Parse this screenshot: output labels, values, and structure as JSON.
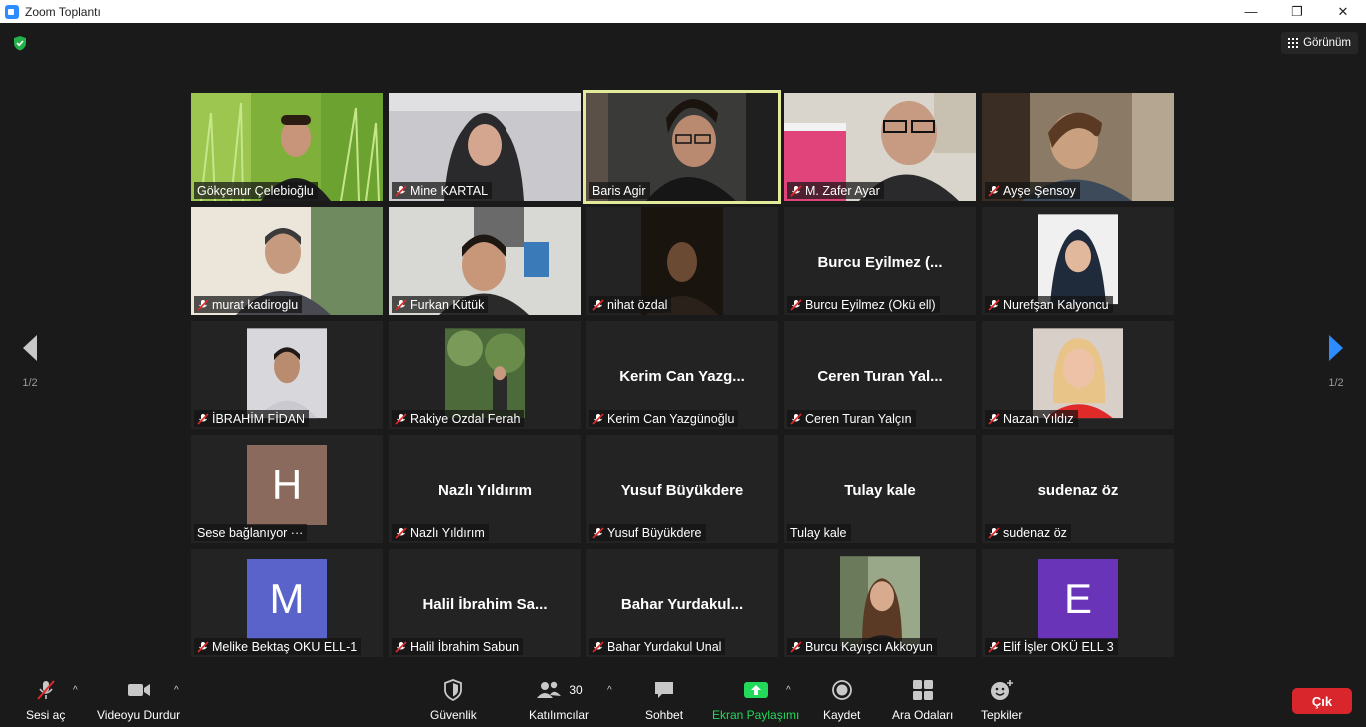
{
  "window": {
    "title": "Zoom Toplantı",
    "controls": [
      "—",
      "❐",
      "✕"
    ]
  },
  "header": {
    "view_label": "Görünüm"
  },
  "pagination": {
    "left": "1/2",
    "right": "1/2"
  },
  "participants": [
    {
      "name": "Gökçenur Çelebioğlu",
      "muted": false
    },
    {
      "name": "Mine KARTAL",
      "muted": true
    },
    {
      "name": "Baris Agir",
      "muted": false
    },
    {
      "name": "M. Zafer Ayar",
      "muted": true
    },
    {
      "name": "Ayşe Şensoy",
      "muted": true
    },
    {
      "name": "murat kadiroglu",
      "muted": true
    },
    {
      "name": "Furkan Kütük",
      "muted": true
    },
    {
      "name": "nihat özdal",
      "muted": true
    },
    {
      "name": "Burcu Eyilmez (Okü ell)",
      "display_name": "Burcu Eyilmez (...",
      "muted": true
    },
    {
      "name": "Nurefşan Kalyoncu",
      "muted": true
    },
    {
      "name": "İBRAHİM FİDAN",
      "muted": true
    },
    {
      "name": "Rakiye Ozdal Ferah",
      "muted": true
    },
    {
      "name": "Kerim Can Yazgünoğlu",
      "display_name": "Kerim Can Yazg...",
      "muted": true
    },
    {
      "name": "Ceren Turan Yalçın",
      "display_name": "Ceren Turan Yal...",
      "muted": true
    },
    {
      "name": "Nazan Yıldız",
      "muted": true
    },
    {
      "name": "Sese bağlanıyor ···",
      "avatar_letter": "H",
      "avatar_color": "#8a6a5c",
      "muted": false
    },
    {
      "name": "Nazlı Yıldırım",
      "display_name": "Nazlı Yıldırım",
      "muted": true
    },
    {
      "name": "Yusuf Büyükdere",
      "display_name": "Yusuf Büyükdere",
      "muted": true
    },
    {
      "name": "Tulay kale",
      "display_name": "Tulay kale",
      "muted": false
    },
    {
      "name": "sudenaz öz",
      "display_name": "sudenaz öz",
      "muted": true
    },
    {
      "name": "Melike Bektaş OKU ELL-1",
      "avatar_letter": "M",
      "avatar_color": "#5a63c9",
      "muted": true
    },
    {
      "name": "Halil İbrahim Sabun",
      "display_name": "Halil İbrahim Sa...",
      "muted": true
    },
    {
      "name": "Bahar Yurdakul Unal",
      "display_name": "Bahar Yurdakul...",
      "muted": true
    },
    {
      "name": "Burcu Kayışcı Akkoyun",
      "muted": true
    },
    {
      "name": "Elif İşler OKÜ ELL 3",
      "avatar_letter": "E",
      "avatar_color": "#6a34b8",
      "muted": true
    }
  ],
  "toolbar": {
    "mute_label": "Sesi aç",
    "video_label": "Videoyu Durdur",
    "security_label": "Güvenlik",
    "participants_label": "Katılımcılar",
    "participants_count": "30",
    "chat_label": "Sohbet",
    "share_label": "Ekran Paylaşımı",
    "record_label": "Kaydet",
    "breakout_label": "Ara Odaları",
    "reactions_label": "Tepkiler",
    "leave_label": "Çık"
  },
  "colors": {
    "share_green": "#23d959",
    "leave_red": "#d9262c",
    "nav_blue": "#2d8cff",
    "speaker_highlight": "#e3ea9a"
  }
}
